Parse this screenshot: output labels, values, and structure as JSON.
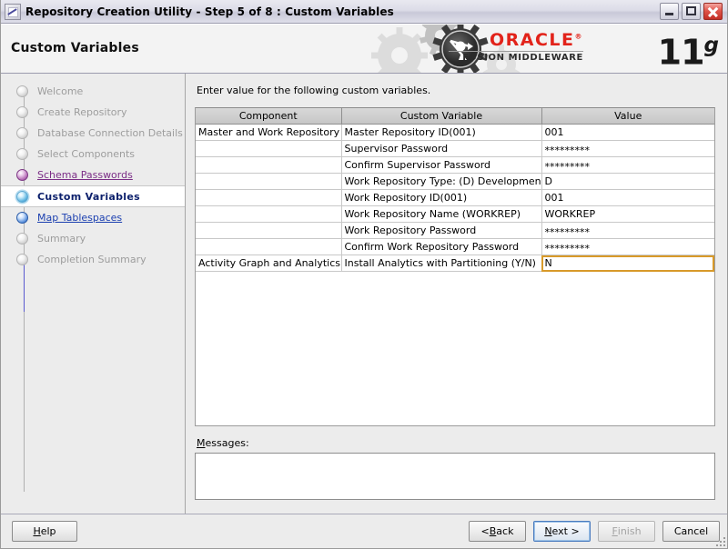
{
  "window": {
    "title": "Repository Creation Utility - Step 5 of 8 : Custom Variables",
    "icon": "app-icon",
    "minimize_label": "Minimize",
    "maximize_label": "Maximize",
    "close_label": "Close"
  },
  "banner": {
    "title": "Custom Variables",
    "oracle": "ORACLE",
    "oracle_trademark": "®",
    "fusion_middleware": "FUSION MIDDLEWARE",
    "version": "11",
    "version_suffix": "g"
  },
  "sidebar": {
    "items": [
      {
        "label": "Welcome",
        "state": "inactive"
      },
      {
        "label": "Create Repository",
        "state": "inactive"
      },
      {
        "label": "Database Connection Details",
        "state": "inactive"
      },
      {
        "label": "Select Components",
        "state": "inactive"
      },
      {
        "label": "Schema Passwords",
        "state": "done"
      },
      {
        "label": "Custom Variables",
        "state": "current"
      },
      {
        "label": "Map Tablespaces",
        "state": "link"
      },
      {
        "label": "Summary",
        "state": "inactive"
      },
      {
        "label": "Completion Summary",
        "state": "inactive"
      }
    ]
  },
  "main": {
    "intro": "Enter value for the following custom variables.",
    "table": {
      "headers": [
        "Component",
        "Custom Variable",
        "Value"
      ],
      "rows": [
        {
          "component": "Master and Work Repository",
          "variable": "Master Repository ID(001)",
          "value": "001",
          "masked": false,
          "selected": false
        },
        {
          "component": "",
          "variable": "Supervisor Password",
          "value": "*********",
          "masked": true,
          "selected": false
        },
        {
          "component": "",
          "variable": "Confirm Supervisor Password",
          "value": "*********",
          "masked": true,
          "selected": false
        },
        {
          "component": "",
          "variable": "Work Repository Type: (D) Developmen...",
          "value": "D",
          "masked": false,
          "selected": false
        },
        {
          "component": "",
          "variable": "Work Repository ID(001)",
          "value": "001",
          "masked": false,
          "selected": false
        },
        {
          "component": "",
          "variable": "Work Repository Name (WORKREP)",
          "value": "WORKREP",
          "masked": false,
          "selected": false
        },
        {
          "component": "",
          "variable": "Work Repository Password",
          "value": "*********",
          "masked": true,
          "selected": false
        },
        {
          "component": "",
          "variable": "Confirm Work Repository Password",
          "value": "*********",
          "masked": true,
          "selected": false
        },
        {
          "component": "Activity Graph and Analytics",
          "variable": "Install Analytics with Partitioning (Y/N)",
          "value": "N",
          "masked": false,
          "selected": true
        }
      ]
    },
    "messages_label_mnemonic": "M",
    "messages_label_rest": "essages:",
    "messages_value": ""
  },
  "footer": {
    "help": "Help",
    "help_mnemonic": "H",
    "help_rest": "elp",
    "back_prefix": "< ",
    "back_mnemonic": "B",
    "back_rest": "ack",
    "next_mnemonic": "N",
    "next_rest": "ext >",
    "finish_mnemonic": "F",
    "finish_rest": "inish",
    "cancel": "Cancel"
  },
  "colors": {
    "oracle_red": "#e2231a",
    "selection_outline": "#d89a2a",
    "done_step": "#7b2d86",
    "link_step": "#1b3fb0",
    "current_step": "#0b1f6b"
  }
}
